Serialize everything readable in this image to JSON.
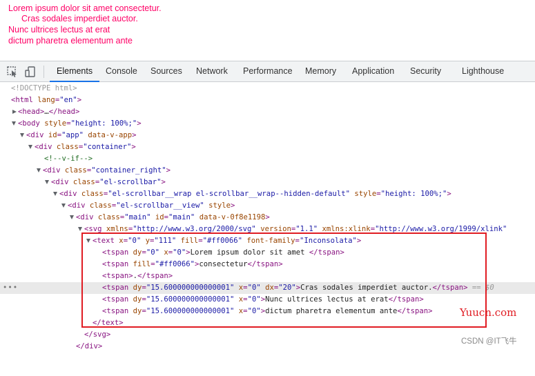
{
  "preview": {
    "color": "#ff0066",
    "lines": [
      "Lorem ipsum dolor sit amet consectetur.",
      "Cras sodales imperdiet auctor.",
      "Nunc ultrices lectus at erat",
      "dictum pharetra elementum ante"
    ]
  },
  "toolbar": {
    "icons": [
      "inspect-element-icon",
      "device-toolbar-icon"
    ],
    "tabs": [
      "Elements",
      "Console",
      "Sources",
      "Network",
      "Performance",
      "Memory",
      "Application",
      "Security",
      "Lighthouse"
    ],
    "active_tab": "Elements"
  },
  "tree": {
    "doctype": "<!DOCTYPE html>",
    "html_tag": "html",
    "html_attr": "lang",
    "html_val": "\"en\"",
    "head_tag": "head",
    "head_ellipsis": "…",
    "body_tag": "body",
    "body_attr": "style",
    "body_val": "\"height: 100%;\"",
    "app_tag": "div",
    "app_attr1": "id",
    "app_val1": "\"app\"",
    "app_attr2": "data-v-app",
    "container_attr": "class",
    "container_val": "\"container\"",
    "comment": "<!--v-if-->",
    "cright_val": "\"container_right\"",
    "scrollbar_val": "\"el-scrollbar\"",
    "wrap_val": "\"el-scrollbar__wrap el-scrollbar__wrap--hidden-default\"",
    "wrap_style_attr": "style",
    "wrap_style_val": "\"height: 100%;\"",
    "view_val": "\"el-scrollbar__view\"",
    "view_style_attr": "style",
    "main_val": "\"main\"",
    "main_id_attr": "id",
    "main_id_val": "\"main\"",
    "main_data_attr": "data-v-0f8e1198",
    "svg_tag": "svg",
    "svg_attr1": "xmlns",
    "svg_val1": "\"http://www.w3.org/2000/svg\"",
    "svg_attr2": "version",
    "svg_val2": "\"1.1\"",
    "svg_attr3": "xmlns:xlink",
    "svg_val3": "\"http://www.w3.org/1999/xlink\"",
    "text_tag": "text",
    "text_x_attr": "x",
    "text_x_val": "\"0\"",
    "text_y_attr": "y",
    "text_y_val": "\"111\"",
    "text_fill_attr": "fill",
    "text_fill_val": "\"#ff0066\"",
    "text_ff_attr": "font-family",
    "text_ff_val": "\"Inconsolata\"",
    "tspan_tag": "tspan",
    "ts1_dy_val": "\"0\"",
    "ts1_x_val": "\"0\"",
    "ts1_text": "Lorem ipsum dolor sit amet ",
    "ts2_fill_val": "\"#ff0066\"",
    "ts2_text": "consectetur",
    "ts3_text": ".",
    "ts_dy_attr": "dy",
    "ts_x_attr": "x",
    "ts_dx_attr": "dx",
    "ts_fill_attr": "fill",
    "ts_dy_long": "\"15.600000000000001\"",
    "ts4_x_val": "\"0\"",
    "ts4_dx_val": "\"20\"",
    "ts4_text": "Cras sodales imperdiet auctor.",
    "selected_marker": " == $0",
    "ts5_text": "Nunc ultrices lectus at erat",
    "ts6_text": "dictum pharetra elementum ante",
    "close_text": "</text>",
    "close_svg": "</svg>",
    "close_div": "</div>",
    "row_dots": "•••"
  },
  "watermark": {
    "site": "Yuucn.com",
    "credit": "CSDN @IT飞牛"
  }
}
